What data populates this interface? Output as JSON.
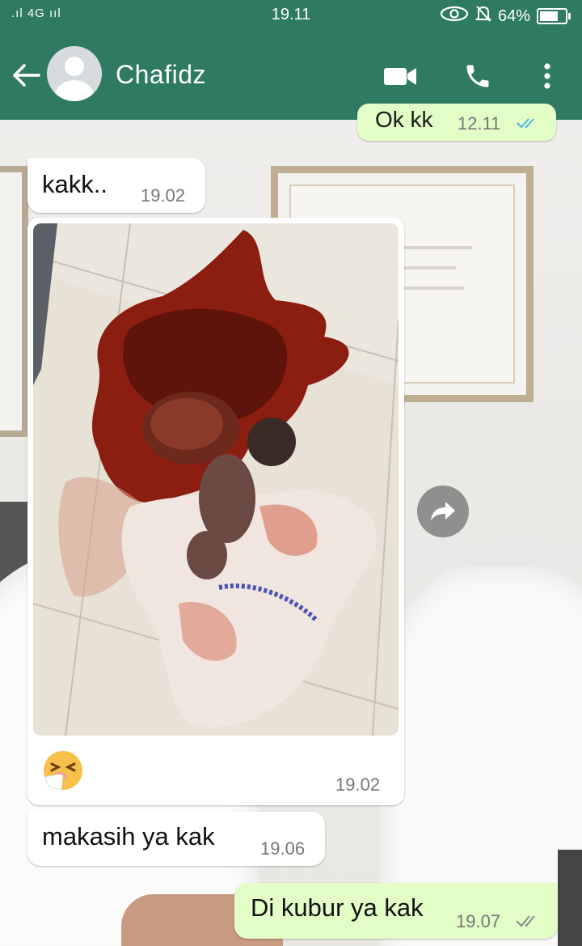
{
  "status_bar": {
    "signal": ".ıl 4G ııl",
    "time": "19.11",
    "battery": "64%",
    "battery_level": 0.64
  },
  "header": {
    "contact_name": "Chafidz",
    "icons": [
      "back-arrow-icon",
      "avatar-icon",
      "video-call-icon",
      "phone-icon",
      "more-vert-icon"
    ]
  },
  "colors": {
    "app_bar": "#2f7a62",
    "incoming_bubble": "#ffffff",
    "outgoing_bubble": "#e2fdc6",
    "read_ticks": "#4fb6ec",
    "delivered_ticks": "#8a8a8a"
  },
  "messages": [
    {
      "direction": "out",
      "text": "Ok kk",
      "time": "12.11",
      "ticks": "read"
    },
    {
      "direction": "in",
      "text": "kakk..",
      "time": "19.02"
    },
    {
      "direction": "in",
      "type": "image",
      "caption_emoji": "sneezing-face-emoji",
      "time": "19.02"
    },
    {
      "direction": "in",
      "text": "makasih ya kak",
      "time": "19.06"
    },
    {
      "direction": "out",
      "text": "Di kubur ya kak",
      "time": "19.07",
      "ticks": "delivered"
    }
  ]
}
